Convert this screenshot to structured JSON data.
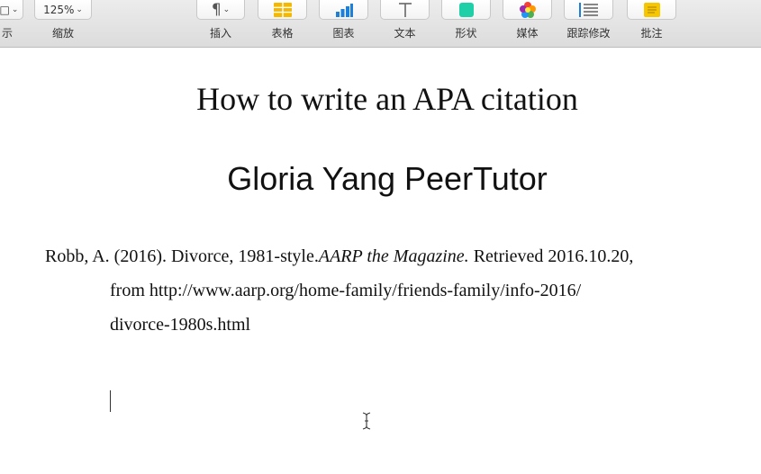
{
  "toolbar": {
    "view": {
      "label": "示"
    },
    "zoom": {
      "value": "125%",
      "label": "缩放"
    },
    "insert": {
      "label": "插入"
    },
    "table": {
      "label": "表格"
    },
    "chart": {
      "label": "图表"
    },
    "text": {
      "label": "文本"
    },
    "shape": {
      "label": "形状"
    },
    "media": {
      "label": "媒体"
    },
    "track_changes": {
      "label": "跟踪修改"
    },
    "comment": {
      "label": "批注"
    }
  },
  "document": {
    "title": "How to write an APA citation",
    "subtitle": "Gloria Yang PeerTutor",
    "citation": {
      "part1": "Robb, A. (2016). Divorce, 1981-style.",
      "journal": "AARP the Magazine.",
      "part2": " Retrieved 2016.10.20,",
      "line2": "from http://www.aarp.org/home-family/friends-family/info-2016/",
      "line3": "divorce-1980s.html"
    }
  },
  "colors": {
    "table_icon": "#f5b800",
    "chart_icon": "#1e7fd8",
    "shape_icon": "#1ecfa8",
    "comment_icon": "#f6c600"
  }
}
